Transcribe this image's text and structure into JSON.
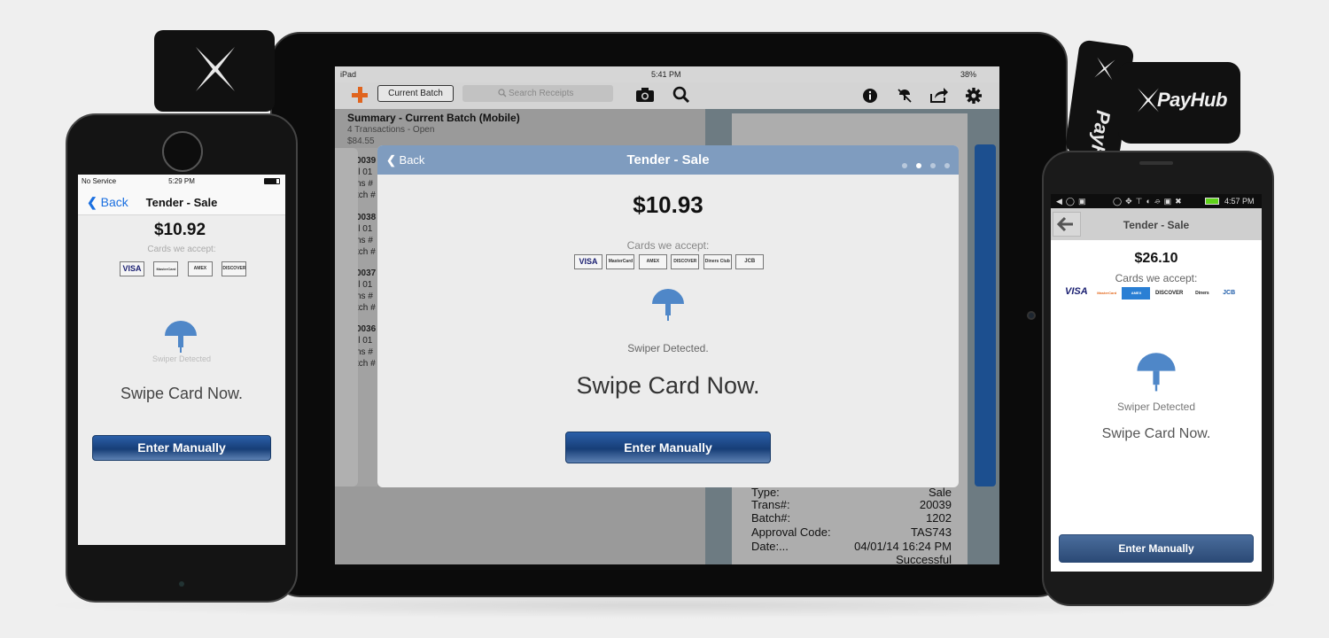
{
  "colors": {
    "accent_blue": "#1c4f8f",
    "orange_plus": "#e0641e",
    "modal_header": "#7f9cbf"
  },
  "ipad": {
    "status": {
      "device": "iPad",
      "time": "5:41 PM",
      "battery": "38%"
    },
    "toolbar": {
      "current_batch": "Current Batch",
      "search_placeholder": "Search Receipts"
    },
    "summary": {
      "title": "Summary - Current Batch (Mobile)",
      "subtitle": "4 Transactions  - Open",
      "amount": "$84.55"
    },
    "list_stubs": [
      [
        "0039",
        "il 01",
        "ns #",
        "tch #"
      ],
      [
        "0038",
        "il 01",
        "ns #",
        "tch #"
      ],
      [
        "0037",
        "il 01",
        "ns #",
        "tch #"
      ],
      [
        "0036",
        "il 01",
        "ns #",
        "tch #"
      ]
    ],
    "receipt": [
      {
        "label": "Type:",
        "value": "Sale"
      },
      {
        "label": "Trans#:",
        "value": "20039"
      },
      {
        "label": "Batch#:",
        "value": "1202"
      },
      {
        "label": "Approval Code:",
        "value": "TAS743"
      },
      {
        "label": "Date:...",
        "value": "04/01/14 16:24 PM"
      },
      {
        "label": "",
        "value": "Successful"
      }
    ],
    "modal": {
      "back": "Back",
      "title": "Tender - Sale",
      "amount": "$10.93",
      "cards_label": "Cards we accept:",
      "cards": [
        "VISA",
        "MasterCard",
        "AMEX",
        "DISCOVER",
        "Diners Club",
        "JCB"
      ],
      "detected": "Swiper Detected.",
      "swipe": "Swipe Card Now.",
      "enter": "Enter Manually"
    }
  },
  "iphone": {
    "status": {
      "carrier": "No Service",
      "time": "5:29 PM"
    },
    "back": "Back",
    "title": "Tender - Sale",
    "amount": "$10.92",
    "cards_label": "Cards we accept:",
    "cards": [
      "VISA",
      "MasterCard",
      "AMEX",
      "DISCOVER"
    ],
    "detected": "Swiper Detected",
    "swipe": "Swipe Card Now.",
    "enter": "Enter Manually"
  },
  "android": {
    "status": {
      "time": "4:57 PM"
    },
    "title": "Tender - Sale",
    "amount": "$26.10",
    "cards_label": "Cards we accept:",
    "cards": [
      "VISA",
      "MasterCard",
      "AMEX",
      "DISCOVER",
      "Diners",
      "JCB"
    ],
    "detected": "Swiper Detected",
    "swipe": "Swipe Card Now.",
    "enter": "Enter Manually"
  },
  "brand": {
    "logo_text": "PayHub",
    "side_text": "PayHub"
  }
}
